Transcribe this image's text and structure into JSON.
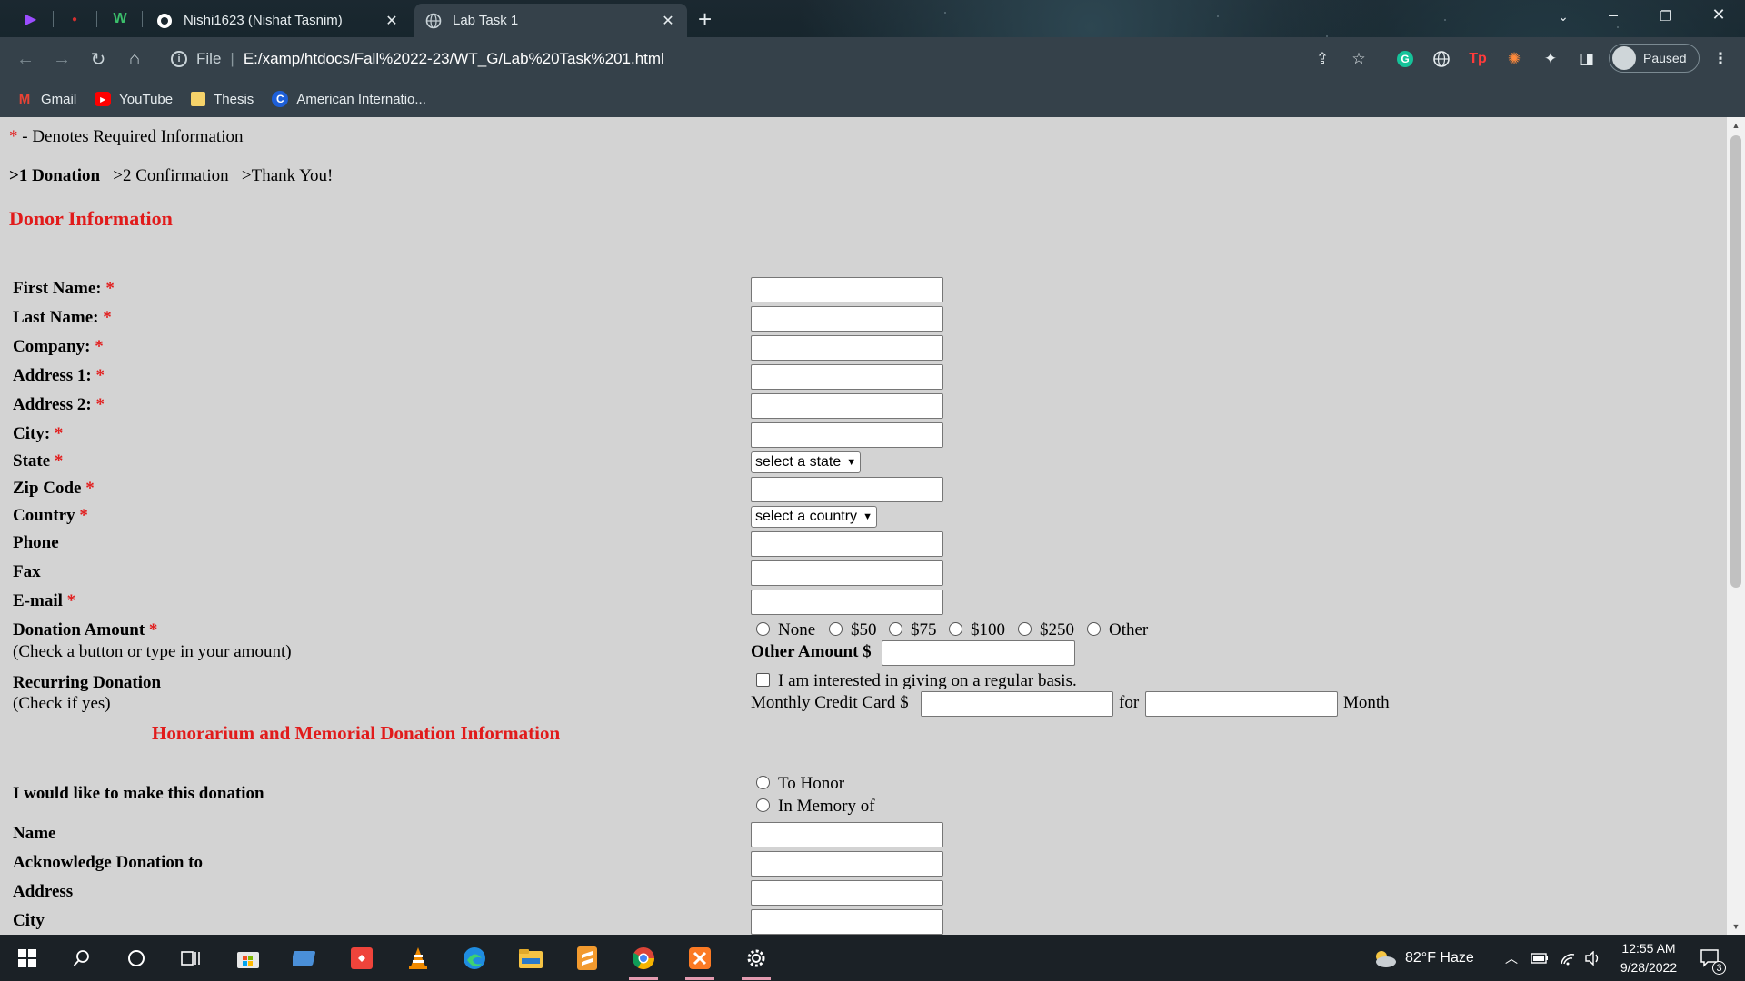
{
  "browser": {
    "tabs": [
      {
        "title": "Nishi1623 (Nishat Tasnim)",
        "icon": "github-icon",
        "active": false
      },
      {
        "title": "Lab Task 1",
        "icon": "globe-icon",
        "active": true
      }
    ],
    "address": {
      "scheme": "File",
      "url": "E:/xamp/htdocs/Fall%2022-23/WT_G/Lab%20Task%201.html"
    },
    "profile_label": "Paused",
    "bookmarks": [
      {
        "label": "Gmail",
        "icon": "gmail-icon"
      },
      {
        "label": "YouTube",
        "icon": "youtube-icon"
      },
      {
        "label": "Thesis",
        "icon": "folder-icon"
      },
      {
        "label": "American Internatio...",
        "icon": "aiub-icon"
      }
    ]
  },
  "page": {
    "required_note": "- Denotes Required Information",
    "asterisk": "*",
    "steps": [
      ">1 Donation",
      ">2 Confirmation",
      ">Thank You!"
    ],
    "donor_heading": "Donor Information",
    "fields": {
      "first_name": "First Name:",
      "last_name": "Last Name:",
      "company": "Company:",
      "address1": "Address 1:",
      "address2": "Address 2:",
      "city": "City:",
      "state": "State",
      "zip": "Zip Code",
      "country": "Country",
      "phone": "Phone",
      "fax": "Fax",
      "email": "E-mail"
    },
    "state_select": "select a state",
    "country_select": "select a country",
    "donation": {
      "label": "Donation Amount",
      "hint": "(Check a button or type in your amount)",
      "options": [
        "None",
        "$50",
        "$75",
        "$100",
        "$250",
        "Other"
      ],
      "other_amount_label": "Other Amount $"
    },
    "recurring": {
      "label": "Recurring Donation",
      "hint": "(Check if yes)",
      "checkbox_label": "I am interested in giving on a regular basis.",
      "monthly_label": "Monthly Credit Card $",
      "for_label": "for",
      "month_label": "Month"
    },
    "honorarium_heading": "Honorarium and Memorial Donation Information",
    "honor": {
      "label": "I would like to make this donation",
      "options": [
        "To Honor",
        "In Memory of"
      ]
    },
    "memorial_fields": {
      "name": "Name",
      "acknowledge": "Acknowledge Donation to",
      "address": "Address",
      "city": "City"
    }
  },
  "taskbar": {
    "weather": "82°F  Haze",
    "time": "12:55 AM",
    "date": "9/28/2022",
    "notifications": "3"
  }
}
